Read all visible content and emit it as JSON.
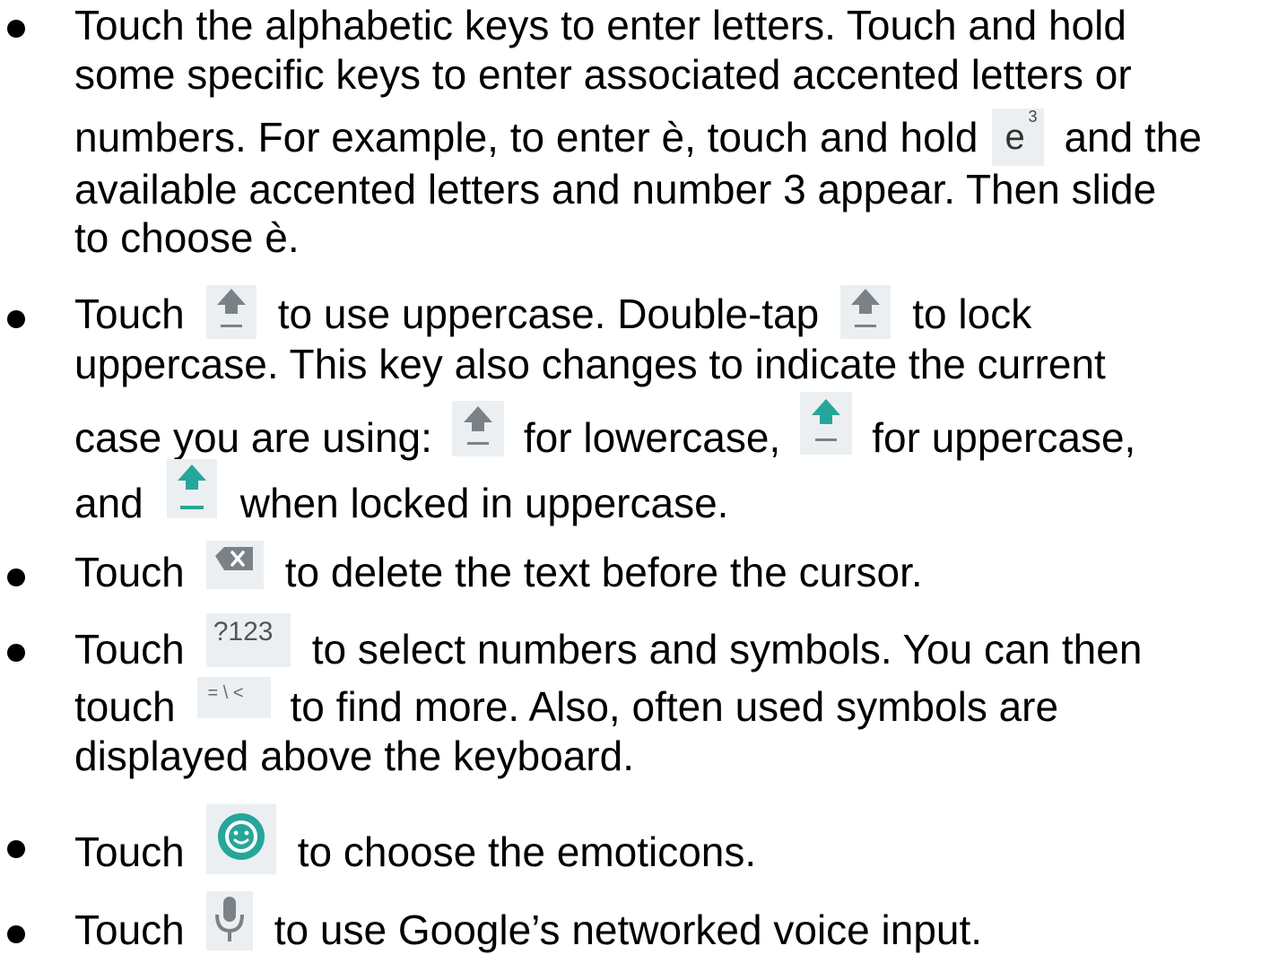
{
  "colors": {
    "text": "#000000",
    "key_bg": "#eceff1",
    "icon_grey": "#7a8288",
    "icon_teal": "#26a69a"
  },
  "items": [
    {
      "lines": [
        "Touch the alphabetic keys to enter letters. Touch and hold",
        "some specific keys to enter associated accented letters or",
        [
          "numbers. For example, to enter è, touch and hold",
          "and the"
        ],
        "available accented letters and number 3 appear. Then slide",
        "to choose è."
      ],
      "key_e": {
        "letter": "e",
        "sup": "3"
      }
    },
    {
      "lines": [
        [
          "Touch",
          "to use uppercase. Double-tap",
          "to lock"
        ],
        "uppercase. This key also changes to indicate the current",
        [
          "case you are using:",
          "for lowercase,",
          "for uppercase,"
        ],
        [
          "and",
          "when locked in uppercase."
        ]
      ],
      "icons": [
        "shift-icon",
        "shift-icon",
        "shift-lowercase-icon",
        "shift-uppercase-icon",
        "shift-locked-icon"
      ]
    },
    {
      "lines": [
        [
          "Touch",
          "to delete the text before the cursor."
        ]
      ],
      "icons": [
        "delete-icon"
      ]
    },
    {
      "lines": [
        [
          "Touch",
          "to select numbers and symbols. You can then"
        ],
        [
          "touch",
          "to find more. Also, often used symbols are"
        ],
        "displayed above the keyboard."
      ],
      "key_symbols": "?123",
      "key_more_symbols": "= \\ <"
    },
    {
      "lines": [
        [
          "Touch",
          "to choose the emoticons."
        ]
      ],
      "icons": [
        "emoticon-icon"
      ]
    },
    {
      "lines": [
        [
          "Touch",
          "to use Google’s networked voice input."
        ]
      ],
      "icons": [
        "microphone-icon"
      ]
    }
  ]
}
